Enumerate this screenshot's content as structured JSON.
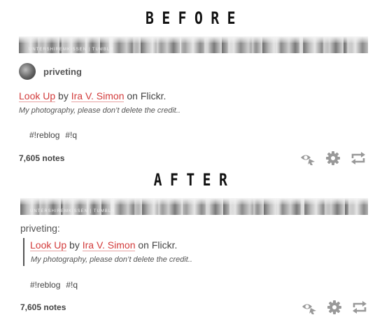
{
  "before": {
    "heading": "BEFORE",
    "banner_text": "UNTERSHIREMKISSEN | TUMBLR",
    "username": "priveting",
    "title_link": "Look Up",
    "by": " by ",
    "author_link": "Ira V. Simon",
    "on": " on Flickr.",
    "caption": "My photography, please don’t delete the credit..",
    "tags": [
      "#!reblog",
      "#!q"
    ],
    "notes": "7,605 notes"
  },
  "after": {
    "heading": "AFTER",
    "banner_text": "UNTERSHIREMKISSEN | TUMBLR",
    "reblogger": "priveting:",
    "title_link": "Look Up",
    "by": " by ",
    "author_link": "Ira V. Simon",
    "on": " on Flickr.",
    "caption": "My photography, please don’t delete the credit..",
    "tags": [
      "#!reblog",
      "#!q"
    ],
    "notes": "7,605 notes"
  },
  "icons": {
    "likes": "eye-like-icon",
    "settings": "gear-icon",
    "reblog": "reblog-arrows-icon"
  },
  "colors": {
    "link": "#d23a3a",
    "icon": "#999999",
    "heading": "#111111"
  }
}
